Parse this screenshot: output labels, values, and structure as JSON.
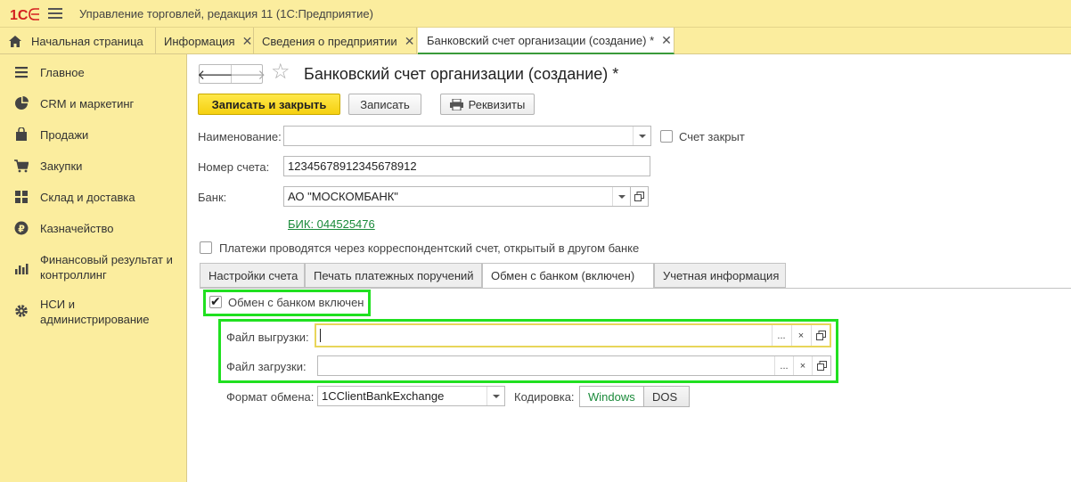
{
  "app": {
    "title": "Управление торговлей, редакция 11  (1С:Предприятие)"
  },
  "tabs": [
    {
      "label": "Начальная страница",
      "closable": false
    },
    {
      "label": "Информация",
      "closable": true
    },
    {
      "label": "Сведения о предприятии",
      "closable": true
    },
    {
      "label": "Банковский счет организации (создание) *",
      "closable": true,
      "active": true
    }
  ],
  "sidebar": {
    "items": [
      {
        "label": "Главное",
        "icon": "list-icon"
      },
      {
        "label": "CRM и маркетинг",
        "icon": "pie-chart-icon"
      },
      {
        "label": "Продажи",
        "icon": "shopping-bag-icon"
      },
      {
        "label": "Закупки",
        "icon": "cart-icon"
      },
      {
        "label": "Склад и доставка",
        "icon": "grid-icon"
      },
      {
        "label": "Казначейство",
        "icon": "ruble-coin-icon"
      },
      {
        "label": "Финансовый результат и контроллинг",
        "icon": "bar-chart-icon"
      },
      {
        "label": "НСИ и администрирование",
        "icon": "gear-icon"
      }
    ]
  },
  "form": {
    "title": "Банковский счет организации (создание) *",
    "buttons": {
      "save_close": "Записать и закрыть",
      "save": "Записать",
      "requisites": "Реквизиты"
    },
    "name_label": "Наименование:",
    "name_value": "",
    "closed_label": "Счет закрыт",
    "closed_checked": false,
    "account_label": "Номер счета:",
    "account_value": "12345678912345678912",
    "bank_label": "Банк:",
    "bank_value": "АО \"МОСКОМБАНК\"",
    "bik_link": "БИК: 044525476",
    "corr_label": "Платежи проводятся через корреспондентский счет, открытый в другом банке",
    "corr_checked": false,
    "form_tabs": [
      {
        "label": "Настройки счета"
      },
      {
        "label": "Печать платежных поручений"
      },
      {
        "label": "Обмен с банком (включен)",
        "active": true
      },
      {
        "label": "Учетная информация"
      }
    ],
    "exchange": {
      "enabled_label": "Обмен с банком включен",
      "enabled_checked": true,
      "upload_label": "Файл выгрузки:",
      "upload_value": "",
      "download_label": "Файл загрузки:",
      "download_value": "",
      "format_label": "Формат обмена:",
      "format_value": "1CClientBankExchange",
      "encoding_label": "Кодировка:",
      "encoding_options": [
        "Windows",
        "DOS"
      ],
      "encoding_selected": "Windows",
      "select_btn": "...",
      "clear_btn": "×"
    }
  },
  "colors": {
    "panel": "#fbed9e",
    "highlight": "#20e020",
    "link": "#1a8a3a",
    "primary_button": "#f5d010"
  }
}
